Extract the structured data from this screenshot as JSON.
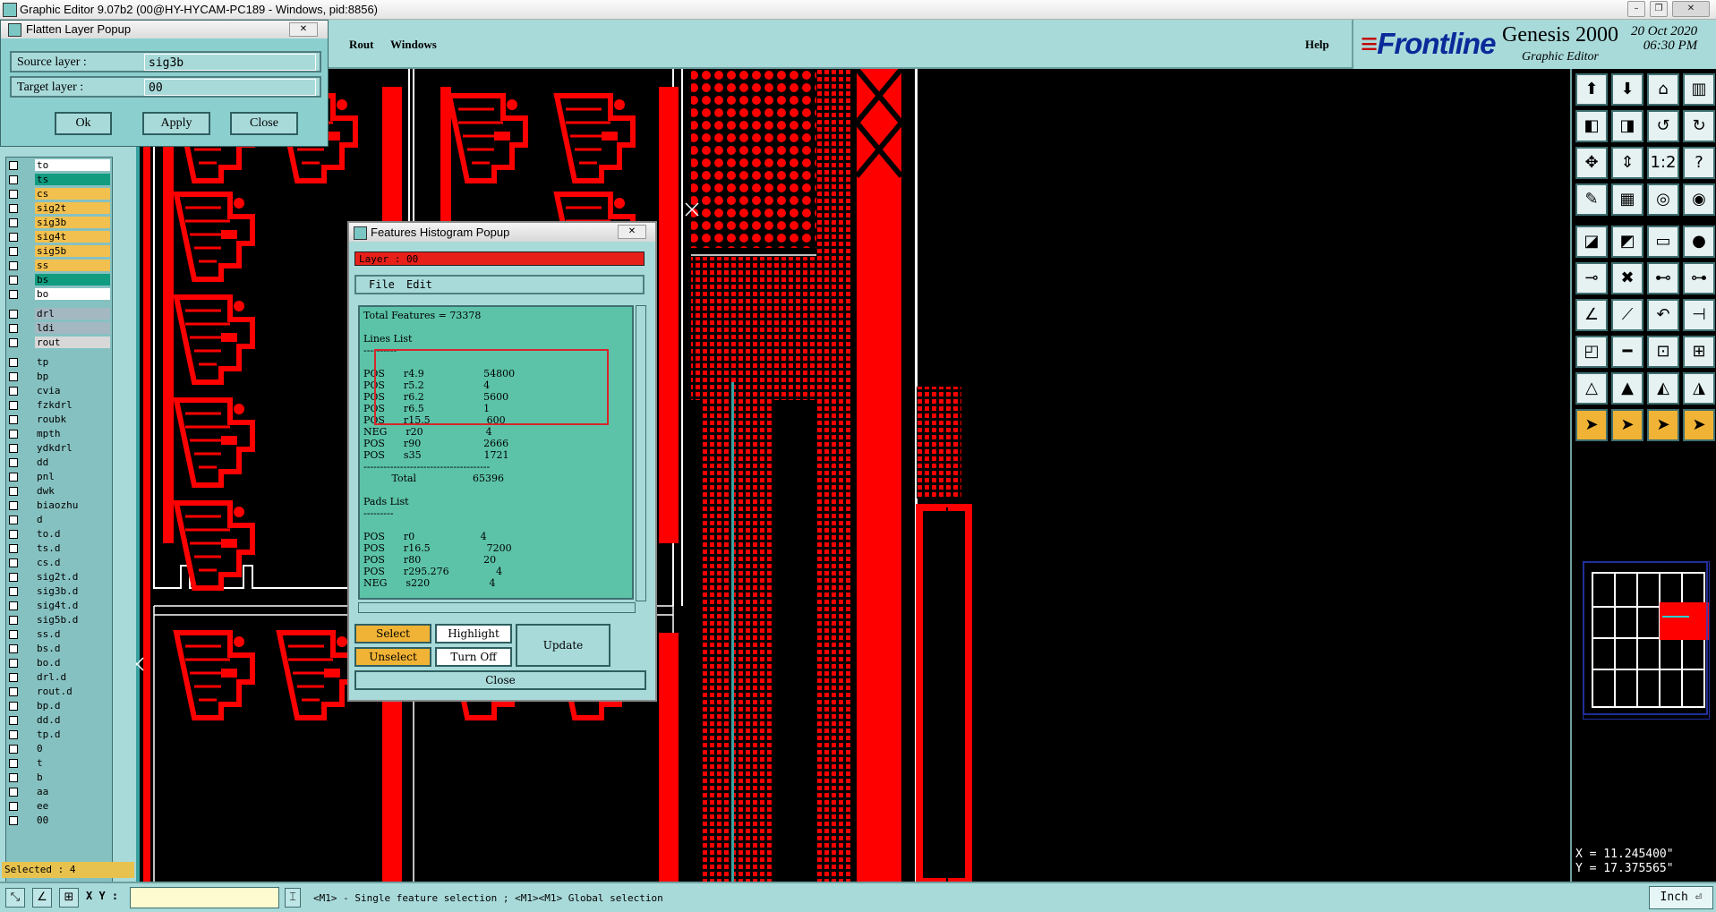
{
  "window": {
    "title": "Graphic Editor 9.07b2 (00@HY-HYCAM-PC189 - Windows, pid:8856)",
    "controls": [
      "minimize",
      "restore",
      "close"
    ]
  },
  "menubar": {
    "items": [
      "Rout",
      "Windows"
    ],
    "help": "Help"
  },
  "brand": {
    "logo": "Frontline",
    "product": "Genesis 2000",
    "subtitle": "Graphic Editor",
    "date": "20 Oct 2020",
    "time": "06:30 PM"
  },
  "flatten_popup": {
    "title": "Flatten Layer Popup",
    "source_label": "Source layer :",
    "source_value": "sig3b",
    "target_label": "Target layer :",
    "target_value": "00",
    "buttons": [
      "Ok",
      "Apply",
      "Close"
    ]
  },
  "layers": [
    {
      "name": "to",
      "color": "#ffffff"
    },
    {
      "name": "ts",
      "color": "#119c80"
    },
    {
      "name": "cs",
      "color": "#f2c04e"
    },
    {
      "name": "sig2t",
      "color": "#f2c04e"
    },
    {
      "name": "sig3b",
      "color": "#f2c04e"
    },
    {
      "name": "sig4t",
      "color": "#f2c04e"
    },
    {
      "name": "sig5b",
      "color": "#f2c04e"
    },
    {
      "name": "ss",
      "color": "#f2c04e"
    },
    {
      "name": "bs",
      "color": "#119c80"
    },
    {
      "name": "bo",
      "color": "#ffffff"
    },
    {
      "name": "drl",
      "color": "#a4b8c2"
    },
    {
      "name": "ldi",
      "color": "#a4b8c2"
    },
    {
      "name": "rout",
      "color": "#d8d8d8"
    },
    {
      "name": "tp",
      "color": "#86c1c1"
    },
    {
      "name": "bp",
      "color": "#86c1c1"
    },
    {
      "name": "cvia",
      "color": "#86c1c1"
    },
    {
      "name": "fzkdrl",
      "color": "#86c1c1"
    },
    {
      "name": "roubk",
      "color": "#86c1c1"
    },
    {
      "name": "mpth",
      "color": "#86c1c1"
    },
    {
      "name": "ydkdrl",
      "color": "#86c1c1"
    },
    {
      "name": "dd",
      "color": "#86c1c1"
    },
    {
      "name": "pnl",
      "color": "#86c1c1"
    },
    {
      "name": "dwk",
      "color": "#86c1c1"
    },
    {
      "name": "biaozhu",
      "color": "#86c1c1"
    },
    {
      "name": "d",
      "color": "#86c1c1"
    },
    {
      "name": "to.d",
      "color": "#86c1c1"
    },
    {
      "name": "ts.d",
      "color": "#86c1c1"
    },
    {
      "name": "cs.d",
      "color": "#86c1c1"
    },
    {
      "name": "sig2t.d",
      "color": "#86c1c1"
    },
    {
      "name": "sig3b.d",
      "color": "#86c1c1"
    },
    {
      "name": "sig4t.d",
      "color": "#86c1c1"
    },
    {
      "name": "sig5b.d",
      "color": "#86c1c1"
    },
    {
      "name": "ss.d",
      "color": "#86c1c1"
    },
    {
      "name": "bs.d",
      "color": "#86c1c1"
    },
    {
      "name": "bo.d",
      "color": "#86c1c1"
    },
    {
      "name": "drl.d",
      "color": "#86c1c1"
    },
    {
      "name": "rout.d",
      "color": "#86c1c1"
    },
    {
      "name": "bp.d",
      "color": "#86c1c1"
    },
    {
      "name": "dd.d",
      "color": "#86c1c1"
    },
    {
      "name": "tp.d",
      "color": "#86c1c1"
    },
    {
      "name": "0",
      "color": "#86c1c1"
    },
    {
      "name": "t",
      "color": "#86c1c1"
    },
    {
      "name": "b",
      "color": "#86c1c1"
    },
    {
      "name": "aa",
      "color": "#86c1c1"
    },
    {
      "name": "ee",
      "color": "#86c1c1"
    },
    {
      "name": "00",
      "color": "#86c1c1"
    }
  ],
  "selected": "Selected : 4",
  "histogram_popup": {
    "title": "Features Histogram Popup",
    "layer": "Layer :  00",
    "menu": [
      "File",
      "Edit"
    ],
    "total_features": "Total Features = 73378",
    "lines_header": "Lines List",
    "lines": [
      {
        "pol": "POS",
        "sym": "r4.9",
        "count": "54800"
      },
      {
        "pol": "POS",
        "sym": "r5.2",
        "count": "4"
      },
      {
        "pol": "POS",
        "sym": "r6.2",
        "count": "5600"
      },
      {
        "pol": "POS",
        "sym": "r6.5",
        "count": "1"
      },
      {
        "pol": "POS",
        "sym": "r15.5",
        "count": "600"
      },
      {
        "pol": "NEG",
        "sym": "r20",
        "count": "4"
      },
      {
        "pol": "POS",
        "sym": "r90",
        "count": "2666"
      },
      {
        "pol": "POS",
        "sym": "s35",
        "count": "1721"
      }
    ],
    "lines_total_label": "Total",
    "lines_total": "65396",
    "pads_header": "Pads List",
    "pads": [
      {
        "pol": "POS",
        "sym": "r0",
        "count": "4"
      },
      {
        "pol": "POS",
        "sym": "r16.5",
        "count": "7200"
      },
      {
        "pol": "POS",
        "sym": "r80",
        "count": "20"
      },
      {
        "pol": "POS",
        "sym": "r295.276",
        "count": "4"
      },
      {
        "pol": "NEG",
        "sym": "s220",
        "count": "4"
      }
    ],
    "buttons": {
      "select": "Select",
      "highlight": "Highlight",
      "update": "Update",
      "unselect": "Unselect",
      "turn_off": "Turn Off",
      "close": "Close"
    }
  },
  "statusbar": {
    "xy_label": "X Y :",
    "xy_value": "",
    "hint": "<M1> - Single feature selection ; <M1><M1> Global selection",
    "units": "Inch"
  },
  "coordinates": {
    "x": "X = 11.245400\"",
    "y": "Y = 17.375565\""
  },
  "colors": {
    "panel": "#a9dada",
    "feature": "#ff0000",
    "background": "#000000",
    "accent": "#f1b335"
  }
}
